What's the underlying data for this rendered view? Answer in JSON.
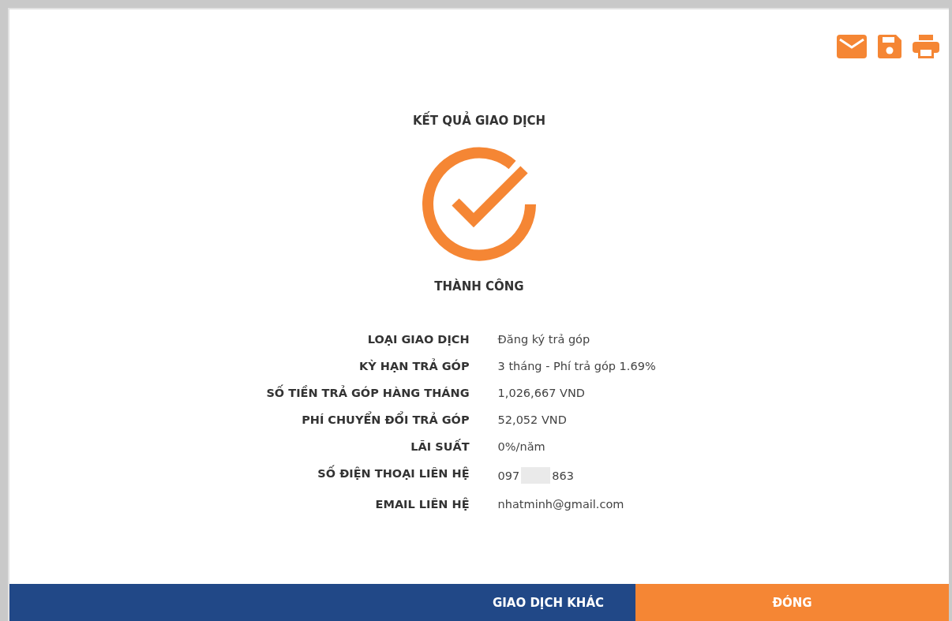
{
  "title": "KẾT QUẢ GIAO DỊCH",
  "status": "THÀNH CÔNG",
  "rows": [
    {
      "kind": "plain",
      "label": "LOẠI GIAO DỊCH",
      "value": "Đăng ký trả góp"
    },
    {
      "kind": "plain",
      "label": "KỲ HẠN TRẢ GÓP",
      "value": "3 tháng - Phí trả góp 1.69%"
    },
    {
      "kind": "plain",
      "label": "SỐ TIỀN TRẢ GÓP HÀNG THÁNG",
      "value": "1,026,667 VND"
    },
    {
      "kind": "plain",
      "label": "PHÍ CHUYỂN ĐỔI TRẢ GÓP",
      "value": "52,052 VND"
    },
    {
      "kind": "plain",
      "label": "LÃI SUẤT",
      "value": "0%/năm"
    },
    {
      "kind": "redacted",
      "label": "SỐ ĐIỆN THOẠI LIÊN HỆ",
      "value": "097",
      "value_end": "863"
    },
    {
      "kind": "plain",
      "label": "EMAIL LIÊN HỆ",
      "value": "nhatminh@gmail.com"
    }
  ],
  "buttons": [
    {
      "label": "GIAO DỊCH KHÁC",
      "kind": "secondary"
    },
    {
      "label": "ĐÓNG",
      "kind": "primary"
    }
  ]
}
